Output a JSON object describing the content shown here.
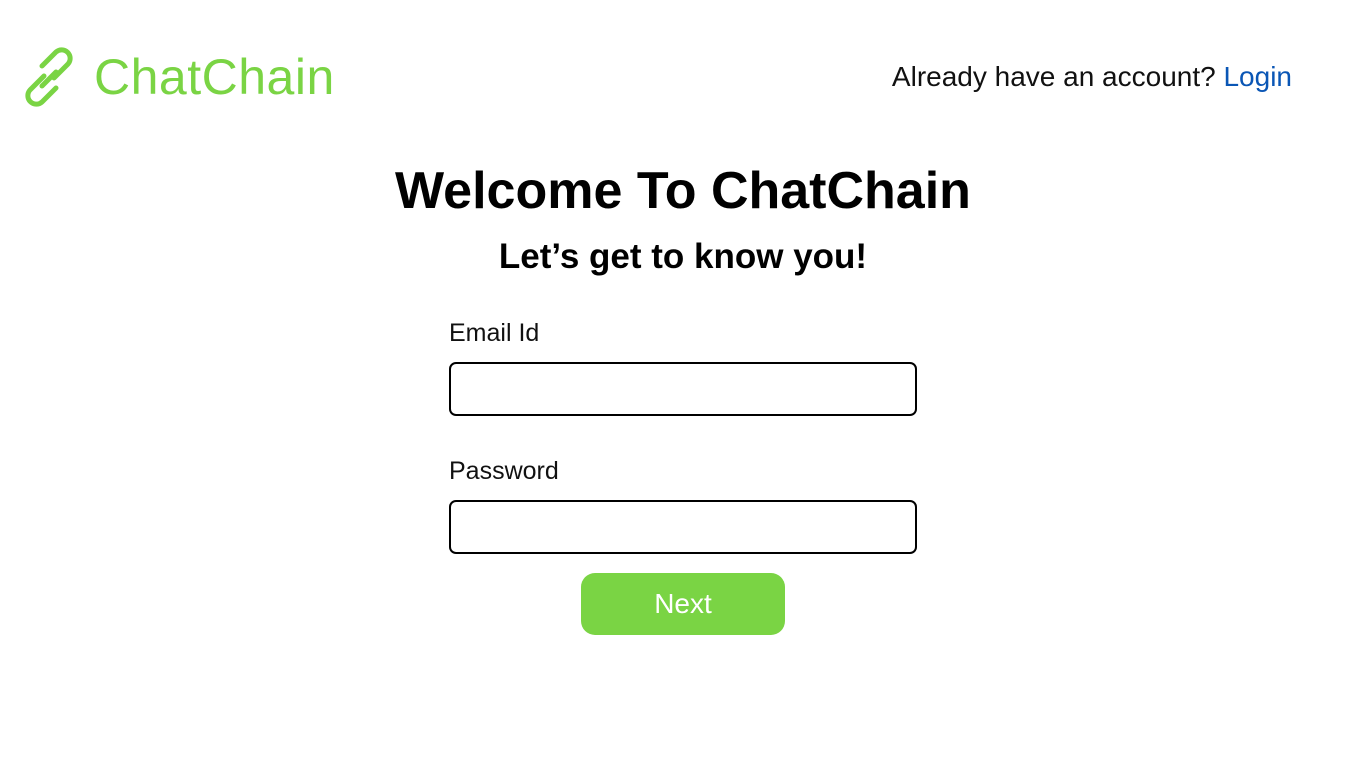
{
  "header": {
    "brand_name": "ChatChain",
    "brand_icon": "link-icon",
    "account_question": "Already have an account?",
    "login_label": "Login"
  },
  "main": {
    "title": "Welcome To ChatChain",
    "subtitle": "Let’s get to know you!"
  },
  "form": {
    "email": {
      "label": "Email Id",
      "value": "",
      "placeholder": ""
    },
    "password": {
      "label": "Password",
      "value": "",
      "placeholder": ""
    },
    "submit_label": "Next"
  },
  "colors": {
    "brand_green": "#7ad444",
    "link_blue": "#0a56b5",
    "text": "#000000",
    "background": "#ffffff"
  }
}
